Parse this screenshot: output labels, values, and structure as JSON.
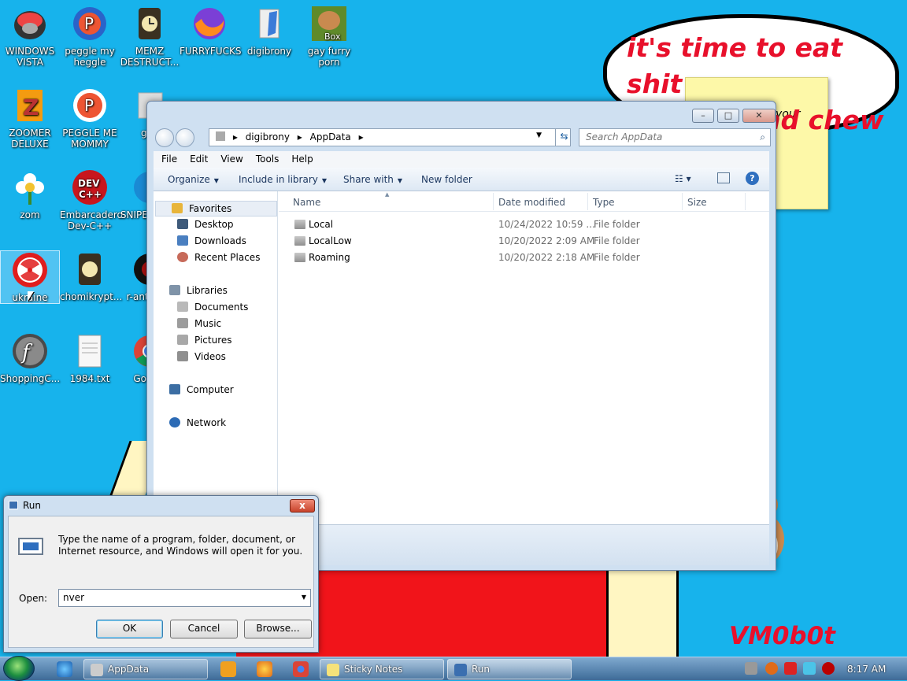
{
  "wallpaper": {
    "bubble_text": "it's time to eat shit\nand die and chew",
    "sticky_note_text": "your",
    "watermark": "VM0b0t"
  },
  "desktop_icons": [
    {
      "label": "WINDOWS VISTA",
      "icon": "vista-icon"
    },
    {
      "label": "peggle my heggle",
      "icon": "peggle-icon"
    },
    {
      "label": "MEMZ DESTRUCT...",
      "icon": "memz-icon"
    },
    {
      "label": "FURRYFUCKS",
      "icon": "firefox-icon"
    },
    {
      "label": "digibrony",
      "icon": "user-folder-icon"
    },
    {
      "label": "gay furry porn",
      "icon": "box-hamster-icon"
    },
    {
      "label": "ZOOMER DELUXE",
      "icon": "zoomer-icon"
    },
    {
      "label": "PEGGLE ME MOMMY",
      "icon": "peggle-icon"
    },
    {
      "label": "gay",
      "icon": "app-icon"
    },
    {
      "label": "zom",
      "icon": "flower-icon"
    },
    {
      "label": "Embarcadero Dev-C++",
      "icon": "devcpp-icon"
    },
    {
      "label": "SNIPE GAME",
      "icon": "snipe-icon"
    },
    {
      "label": "ukraine",
      "icon": "radiation-icon"
    },
    {
      "label": "chomikrypt...",
      "icon": "chomikrypt-icon"
    },
    {
      "label": "r-ant pare",
      "icon": "app-icon"
    },
    {
      "label": "ShoppingC...",
      "icon": "flash-icon"
    },
    {
      "label": "1984.txt",
      "icon": "text-file-icon"
    },
    {
      "label": "Go Chr",
      "icon": "chrome-icon"
    }
  ],
  "explorer": {
    "title_buttons": {
      "minimize": "–",
      "maximize": "□",
      "close": "✕"
    },
    "breadcrumb": [
      "digibrony",
      "AppData"
    ],
    "search_placeholder": "Search AppData",
    "menu": [
      "File",
      "Edit",
      "View",
      "Tools",
      "Help"
    ],
    "commands": [
      "Organize",
      "Include in library",
      "Share with",
      "New folder"
    ],
    "nav": {
      "favorites_header": "Favorites",
      "favorites": [
        "Desktop",
        "Downloads",
        "Recent Places"
      ],
      "libraries_header": "Libraries",
      "libraries": [
        "Documents",
        "Music",
        "Pictures",
        "Videos"
      ],
      "computer": "Computer",
      "network": "Network"
    },
    "columns": [
      "Name",
      "Date modified",
      "Type",
      "Size"
    ],
    "rows": [
      {
        "name": "Local",
        "date": "10/24/2022 10:59 ...",
        "type": "File folder"
      },
      {
        "name": "LocalLow",
        "date": "10/20/2022 2:09 AM",
        "type": "File folder"
      },
      {
        "name": "Roaming",
        "date": "10/20/2022 2:18 AM",
        "type": "File folder"
      }
    ]
  },
  "run_dialog": {
    "title": "Run",
    "close": "x",
    "description": "Type the name of a program, folder, document, or Internet resource, and Windows will open it for you.",
    "open_label": "Open:",
    "open_value": "nver",
    "ok": "OK",
    "cancel": "Cancel",
    "browse": "Browse..."
  },
  "taskbar": {
    "buttons": [
      {
        "label": "AppData"
      },
      {
        "label": "Sticky Notes"
      },
      {
        "label": "Run"
      }
    ],
    "clock": "8:17 AM"
  }
}
